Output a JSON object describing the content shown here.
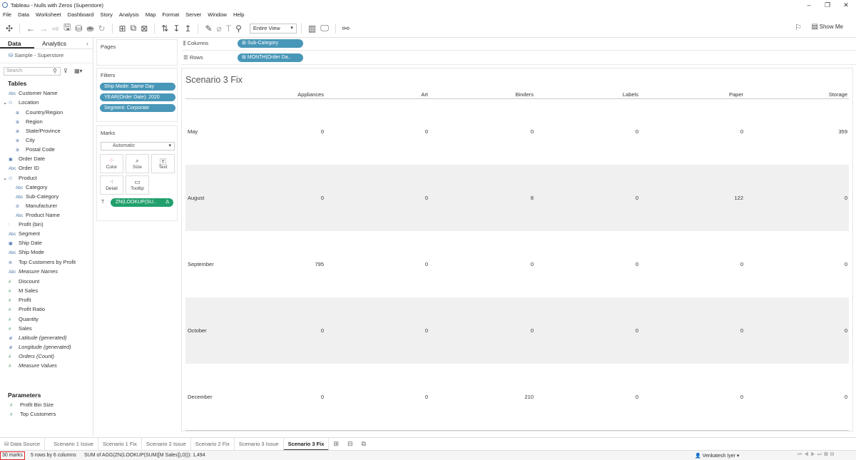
{
  "window": {
    "title": "Tableau - Nulls with Zeros (Superstore)"
  },
  "menu": [
    "File",
    "Data",
    "Worksheet",
    "Dashboard",
    "Story",
    "Analysis",
    "Map",
    "Format",
    "Server",
    "Window",
    "Help"
  ],
  "toolbar": {
    "fit": "Entire View",
    "show_me": "Show Me"
  },
  "data_pane": {
    "tabs": {
      "data": "Data",
      "analytics": "Analytics"
    },
    "datasource": "Sample - Superstore",
    "search_placeholder": "Search",
    "tables_heading": "Tables",
    "fields": [
      {
        "label": "Customer Name",
        "icon": "Abc"
      },
      {
        "label": "Location",
        "icon": "hierarchy"
      },
      {
        "label": "Country/Region",
        "icon": "globe"
      },
      {
        "label": "Region",
        "icon": "globe"
      },
      {
        "label": "State/Province",
        "icon": "globe"
      },
      {
        "label": "City",
        "icon": "globe"
      },
      {
        "label": "Postal Code",
        "icon": "globe"
      },
      {
        "label": "Order Date",
        "icon": "calendar"
      },
      {
        "label": "Order ID",
        "icon": "Abc"
      },
      {
        "label": "Product",
        "icon": "hierarchy"
      },
      {
        "label": "Category",
        "icon": "Abc"
      },
      {
        "label": "Sub-Category",
        "icon": "Abc"
      },
      {
        "label": "Manufacturer",
        "icon": "paperclip"
      },
      {
        "label": "Product Name",
        "icon": "Abc"
      },
      {
        "label": "Profit (bin)",
        "icon": "bins"
      },
      {
        "label": "Segment",
        "icon": "Abc"
      },
      {
        "label": "Ship Date",
        "icon": "calendar"
      },
      {
        "label": "Ship Mode",
        "icon": "Abc"
      },
      {
        "label": "Top Customers by Profit",
        "icon": "set"
      },
      {
        "label": "Measure Names",
        "icon": "Abc"
      },
      {
        "label": "Discount",
        "icon": "#"
      },
      {
        "label": "M Sales",
        "icon": "#"
      },
      {
        "label": "Profit",
        "icon": "#"
      },
      {
        "label": "Profit Ratio",
        "icon": "#"
      },
      {
        "label": "Quantity",
        "icon": "#"
      },
      {
        "label": "Sales",
        "icon": "#"
      },
      {
        "label": "Latitude (generated)",
        "icon": "globe"
      },
      {
        "label": "Longitude (generated)",
        "icon": "globe"
      },
      {
        "label": "Orders (Count)",
        "icon": "#"
      },
      {
        "label": "Measure Values",
        "icon": "#"
      }
    ],
    "parameters_heading": "Parameters",
    "parameters": [
      "Profit Bin Size",
      "Top Customers"
    ]
  },
  "cards": {
    "pages": "Pages",
    "filters": "Filters",
    "filter_pills": [
      "Ship Mode: Same Day",
      "YEAR(Order Date): 2020",
      "Segment: Corporate"
    ],
    "marks": "Marks",
    "mark_type": "Automatic",
    "mark_buttons": [
      "Color",
      "Size",
      "Text",
      "Detail",
      "Tooltip"
    ],
    "mark_pill": "ZN(LOOKUP(SU..",
    "mark_pill_delta": "Δ"
  },
  "shelves": {
    "columns_label": "Columns",
    "columns_pill": "Sub-Category",
    "rows_label": "Rows",
    "rows_pill": "MONTH(Order Da.."
  },
  "view": {
    "title": "Scenario 3 Fix",
    "columns": [
      "Appliances",
      "Art",
      "Binders",
      "Labels",
      "Paper",
      "Storage"
    ],
    "rows": [
      {
        "label": "May",
        "values": [
          "0",
          "0",
          "0",
          "0",
          "0",
          "359"
        ]
      },
      {
        "label": "August",
        "values": [
          "0",
          "0",
          "8",
          "0",
          "122",
          "0"
        ]
      },
      {
        "label": "September",
        "values": [
          "795",
          "0",
          "0",
          "0",
          "0",
          "0"
        ]
      },
      {
        "label": "October",
        "values": [
          "0",
          "0",
          "0",
          "0",
          "0",
          "0"
        ]
      },
      {
        "label": "December",
        "values": [
          "0",
          "0",
          "210",
          "0",
          "0",
          "0"
        ]
      }
    ]
  },
  "sheet_tabs": {
    "datasource": "Data Source",
    "tabs": [
      "Scenario 1 Issue",
      "Scenario 1 Fix",
      "Scenario 2 Issue",
      "Scenario 2 Fix",
      "Scenario 3 Issue",
      "Scenario 3 Fix"
    ],
    "active": "Scenario 3 Fix"
  },
  "status": {
    "marks": "30 marks",
    "rows_cols": "5 rows by 6 columns",
    "sum": "SUM of AGG(ZN(LOOKUP(SUM([M Sales]),0))): 1,494",
    "user": "Venkatesh Iyer"
  }
}
